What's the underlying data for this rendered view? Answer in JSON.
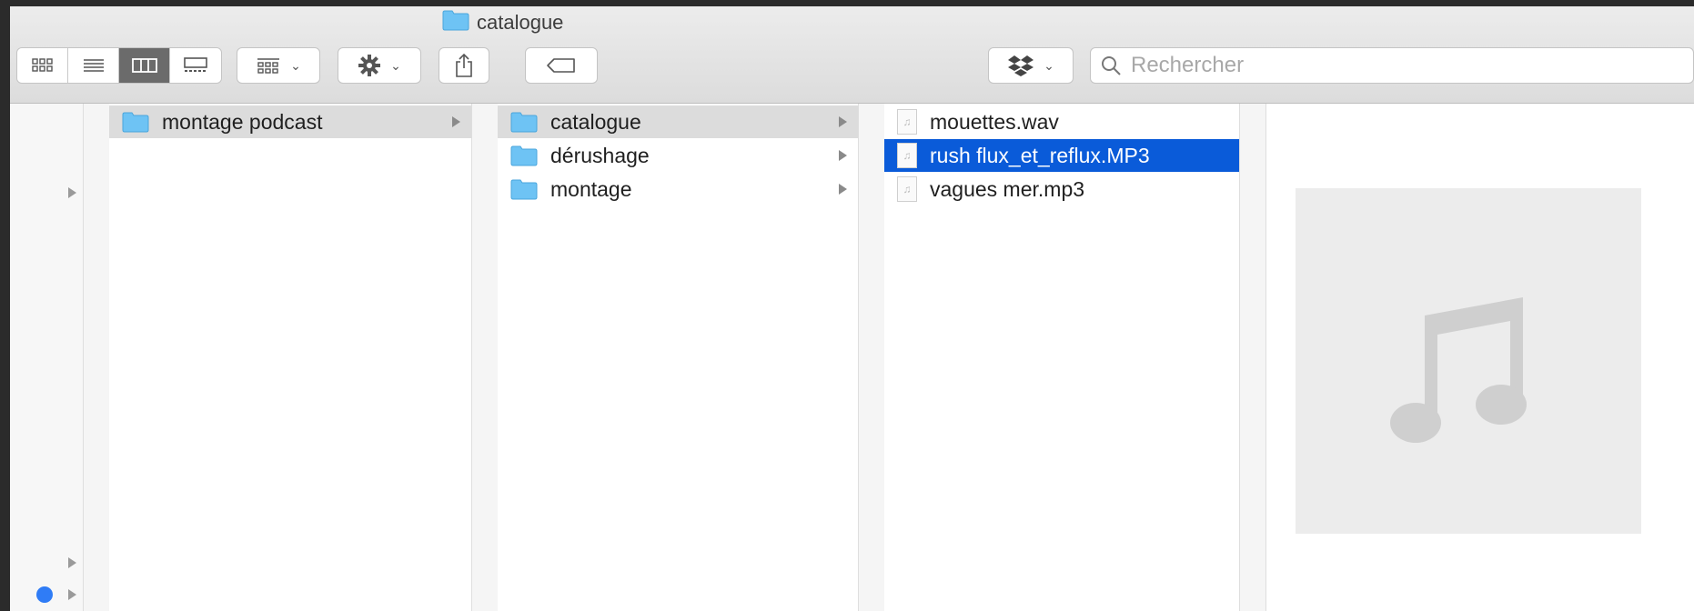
{
  "window": {
    "title": "catalogue"
  },
  "toolbar": {
    "views": [
      "icon-view",
      "list-view",
      "column-view",
      "gallery-view"
    ],
    "active_view": "column-view"
  },
  "search": {
    "placeholder": "Rechercher",
    "value": ""
  },
  "columns": {
    "col1": [
      {
        "label": "montage podcast",
        "type": "folder",
        "selected": true
      }
    ],
    "col2": [
      {
        "label": "catalogue",
        "type": "folder",
        "selected": true
      },
      {
        "label": "dérushage",
        "type": "folder",
        "selected": false
      },
      {
        "label": "montage",
        "type": "folder",
        "selected": false
      }
    ],
    "col3": [
      {
        "label": "mouettes.wav",
        "type": "audio",
        "selected": false
      },
      {
        "label": "rush flux_et_reflux.MP3",
        "type": "audio",
        "selected": true
      },
      {
        "label": "vagues mer.mp3",
        "type": "audio",
        "selected": false
      }
    ]
  },
  "colors": {
    "selection_blue": "#0a5bd9",
    "tag_blue": "#2f7cf6",
    "folder": "#6ec3f4"
  }
}
